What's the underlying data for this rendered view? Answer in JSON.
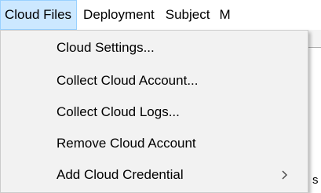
{
  "menubar": {
    "items": [
      {
        "label": "Cloud Files",
        "active": true
      },
      {
        "label": "Deployment"
      },
      {
        "label": "Subject"
      },
      {
        "label": "M"
      }
    ]
  },
  "dropdown": {
    "items": [
      {
        "label": "Cloud Settings..."
      },
      {
        "label": "Collect Cloud Account..."
      },
      {
        "label": "Collect Cloud Logs..."
      },
      {
        "label": "Remove Cloud Account"
      },
      {
        "label": "Add Cloud Credential",
        "submenu": true,
        "submenu_icon": "chevron-right-icon"
      }
    ]
  },
  "background": {
    "partial_glyph": "s"
  },
  "colors": {
    "active_menu_bg": "#cce8ff",
    "active_menu_border": "#99d1ff",
    "dropdown_bg": "#f2f2f2"
  }
}
